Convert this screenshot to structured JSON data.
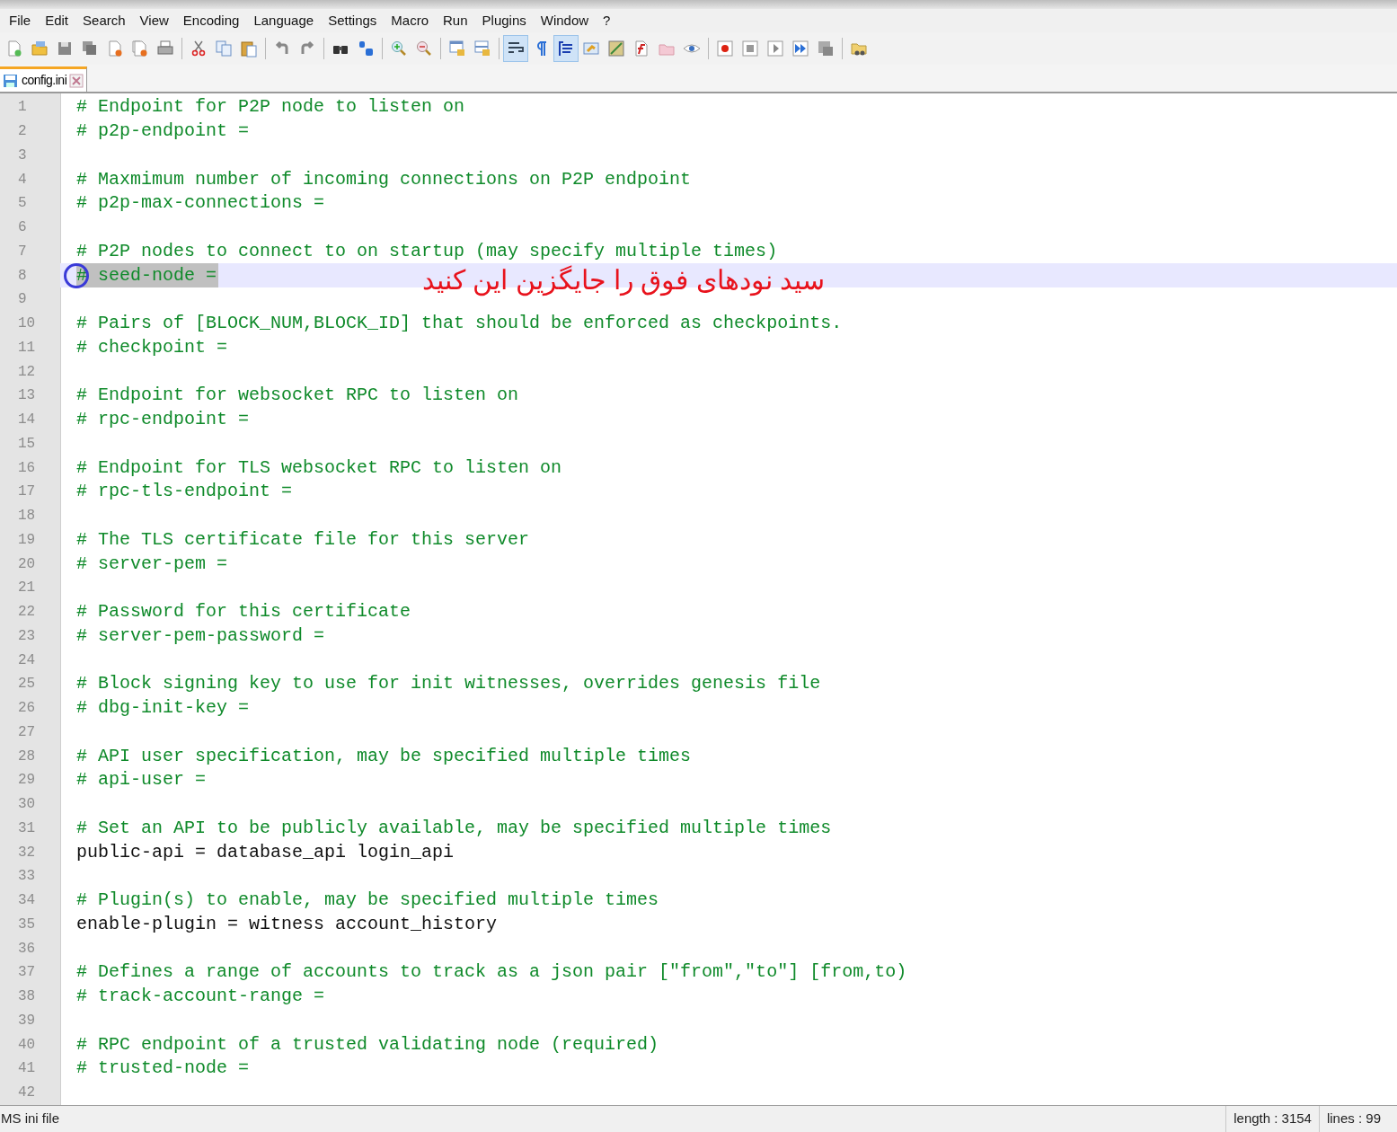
{
  "menu": [
    "File",
    "Edit",
    "Search",
    "View",
    "Encoding",
    "Language",
    "Settings",
    "Macro",
    "Run",
    "Plugins",
    "Window",
    "?"
  ],
  "toolbar": [
    {
      "pressed": false
    },
    {
      "pressed": false
    },
    {
      "pressed": false
    },
    {
      "pressed": false
    },
    {
      "pressed": false
    },
    {
      "pressed": false
    },
    {
      "pressed": false
    },
    {
      "pressed": false
    },
    {
      "pressed": false
    },
    {
      "pressed": false
    },
    {
      "pressed": false
    },
    {
      "pressed": false
    },
    {
      "pressed": false
    },
    {
      "pressed": false
    },
    {
      "pressed": false
    },
    {
      "pressed": false
    },
    {
      "pressed": false
    },
    {
      "pressed": false
    },
    {
      "pressed": true
    },
    {
      "pressed": false
    },
    {
      "pressed": true
    },
    {
      "pressed": false
    },
    {
      "pressed": false
    },
    {
      "pressed": false
    },
    {
      "pressed": false
    },
    {
      "pressed": false
    },
    {
      "pressed": false
    },
    {
      "pressed": false
    },
    {
      "pressed": false
    },
    {
      "pressed": false
    },
    {
      "pressed": false
    },
    {
      "pressed": false
    }
  ],
  "tabs": [
    {
      "label": "config.ini",
      "selected": true
    }
  ],
  "lines": [
    {
      "number": "1",
      "kind": "comment",
      "text": "# Endpoint for P2P node to listen on",
      "current": false,
      "selected": false
    },
    {
      "number": "2",
      "kind": "comment",
      "text": "# p2p-endpoint =",
      "current": false,
      "selected": false
    },
    {
      "number": "3",
      "current": false
    },
    {
      "number": "4",
      "kind": "comment",
      "text": "# Maxmimum number of incoming connections on P2P endpoint",
      "current": false,
      "selected": false
    },
    {
      "number": "5",
      "kind": "comment",
      "text": "# p2p-max-connections =",
      "current": false,
      "selected": false
    },
    {
      "number": "6",
      "current": false
    },
    {
      "number": "7",
      "kind": "comment",
      "text": "# P2P nodes to connect to on startup (may specify multiple times)",
      "current": false,
      "selected": false
    },
    {
      "number": "8",
      "kind": "comment",
      "text": "# seed-node =",
      "current": true,
      "selected": true
    },
    {
      "number": "9",
      "current": false
    },
    {
      "number": "10",
      "kind": "comment",
      "text": "# Pairs of [BLOCK_NUM,BLOCK_ID] that should be enforced as checkpoints.",
      "current": false,
      "selected": false
    },
    {
      "number": "11",
      "kind": "comment",
      "text": "# checkpoint =",
      "current": false,
      "selected": false
    },
    {
      "number": "12",
      "current": false
    },
    {
      "number": "13",
      "kind": "comment",
      "text": "# Endpoint for websocket RPC to listen on",
      "current": false,
      "selected": false
    },
    {
      "number": "14",
      "kind": "comment",
      "text": "# rpc-endpoint =",
      "current": false,
      "selected": false
    },
    {
      "number": "15",
      "current": false
    },
    {
      "number": "16",
      "kind": "comment",
      "text": "# Endpoint for TLS websocket RPC to listen on",
      "current": false,
      "selected": false
    },
    {
      "number": "17",
      "kind": "comment",
      "text": "# rpc-tls-endpoint =",
      "current": false,
      "selected": false
    },
    {
      "number": "18",
      "current": false
    },
    {
      "number": "19",
      "kind": "comment",
      "text": "# The TLS certificate file for this server",
      "current": false,
      "selected": false
    },
    {
      "number": "20",
      "kind": "comment",
      "text": "# server-pem =",
      "current": false,
      "selected": false
    },
    {
      "number": "21",
      "current": false
    },
    {
      "number": "22",
      "kind": "comment",
      "text": "# Password for this certificate",
      "current": false,
      "selected": false
    },
    {
      "number": "23",
      "kind": "comment",
      "text": "# server-pem-password =",
      "current": false,
      "selected": false
    },
    {
      "number": "24",
      "current": false
    },
    {
      "number": "25",
      "kind": "comment",
      "text": "# Block signing key to use for init witnesses, overrides genesis file",
      "current": false,
      "selected": false
    },
    {
      "number": "26",
      "kind": "comment",
      "text": "# dbg-init-key =",
      "current": false,
      "selected": false
    },
    {
      "number": "27",
      "current": false
    },
    {
      "number": "28",
      "kind": "comment",
      "text": "# API user specification, may be specified multiple times",
      "current": false,
      "selected": false
    },
    {
      "number": "29",
      "kind": "comment",
      "text": "# api-user =",
      "current": false,
      "selected": false
    },
    {
      "number": "30",
      "current": false
    },
    {
      "number": "31",
      "kind": "comment",
      "text": "# Set an API to be publicly available, may be specified multiple times",
      "current": false,
      "selected": false
    },
    {
      "number": "32",
      "kind": "code",
      "text": "public-api = database_api login_api",
      "current": false,
      "selected": false
    },
    {
      "number": "33",
      "current": false
    },
    {
      "number": "34",
      "kind": "comment",
      "text": "# Plugin(s) to enable, may be specified multiple times",
      "current": false,
      "selected": false
    },
    {
      "number": "35",
      "kind": "code",
      "text": "enable-plugin = witness account_history",
      "current": false,
      "selected": false
    },
    {
      "number": "36",
      "current": false
    },
    {
      "number": "37",
      "kind": "comment",
      "text": "# Defines a range of accounts to track as a json pair [\"from\",\"to\"] [from,to)",
      "current": false,
      "selected": false
    },
    {
      "number": "38",
      "kind": "comment",
      "text": "# track-account-range =",
      "current": false,
      "selected": false
    },
    {
      "number": "39",
      "current": false
    },
    {
      "number": "40",
      "kind": "comment",
      "text": "# RPC endpoint of a trusted validating node (required)",
      "current": false,
      "selected": false
    },
    {
      "number": "41",
      "kind": "comment",
      "text": "# trusted-node =",
      "current": false,
      "selected": false
    },
    {
      "number": "42",
      "current": false
    }
  ],
  "annotation": "سید نودهای فوق را جایگزین این کنید",
  "status_bar": {
    "file_type": "MS ini file",
    "length": "length : 3154",
    "lines": "lines : 99"
  }
}
